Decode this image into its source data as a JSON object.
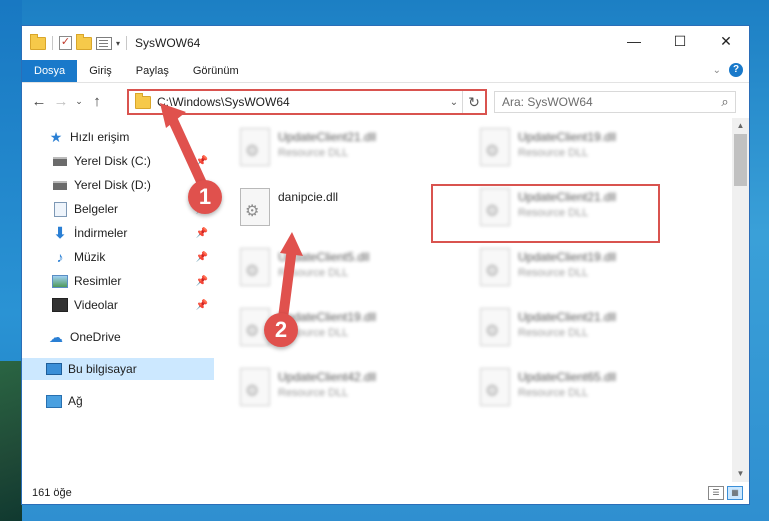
{
  "window": {
    "title": "SysWOW64",
    "controls": {
      "minimize": "—",
      "maximize": "☐",
      "close": "✕"
    }
  },
  "ribbon": {
    "tabs": [
      "Dosya",
      "Giriş",
      "Paylaş",
      "Görünüm"
    ],
    "active_tab": "Dosya",
    "help": "?"
  },
  "nav": {
    "back": "←",
    "forward": "→",
    "recent": "⌄",
    "up": "↑",
    "address": "C:\\Windows\\SysWOW64",
    "search_placeholder": "Ara: SysWOW64"
  },
  "sidebar": {
    "items": [
      {
        "label": "Hızlı erişim",
        "icon": "star-icon",
        "pinned": false
      },
      {
        "label": "Yerel Disk (C:)",
        "icon": "disk-icon",
        "pinned": true
      },
      {
        "label": "Yerel Disk (D:)",
        "icon": "disk-icon",
        "pinned": true
      },
      {
        "label": "Belgeler",
        "icon": "documents-icon",
        "pinned": true
      },
      {
        "label": "İndirmeler",
        "icon": "download-icon",
        "pinned": true
      },
      {
        "label": "Müzik",
        "icon": "music-icon",
        "pinned": true
      },
      {
        "label": "Resimler",
        "icon": "pictures-icon",
        "pinned": true
      },
      {
        "label": "Videolar",
        "icon": "videos-icon",
        "pinned": true
      },
      {
        "label": "OneDrive",
        "icon": "cloud-icon",
        "pinned": false
      },
      {
        "label": "Bu bilgisayar",
        "icon": "computer-icon",
        "pinned": false,
        "selected": true
      },
      {
        "label": "Ağ",
        "icon": "network-icon",
        "pinned": false
      }
    ]
  },
  "files": [
    {
      "name": "UpdateClient21.dll",
      "type": "Resource DLL",
      "blurred": true
    },
    {
      "name": "UpdateClient19.dll",
      "type": "Resource DLL",
      "blurred": true
    },
    {
      "name": "danipcie.dll",
      "type": "",
      "blurred": false,
      "highlighted": true
    },
    {
      "name": "UpdateClient21.dll",
      "type": "Resource DLL",
      "blurred": true
    },
    {
      "name": "UpdateClient5.dll",
      "type": "Resource DLL",
      "blurred": true
    },
    {
      "name": "UpdateClient19.dll",
      "type": "Resource DLL",
      "blurred": true
    },
    {
      "name": "UpdateClient19.dll",
      "type": "Resource DLL",
      "blurred": true
    },
    {
      "name": "UpdateClient21.dll",
      "type": "Resource DLL",
      "blurred": true
    },
    {
      "name": "UpdateClient42.dll",
      "type": "Resource DLL",
      "blurred": true
    },
    {
      "name": "UpdateClient65.dll",
      "type": "Resource DLL",
      "blurred": true
    }
  ],
  "status": {
    "count": "161 öğe"
  },
  "annotations": {
    "step1": "1",
    "step2": "2",
    "color": "#e0514d"
  }
}
